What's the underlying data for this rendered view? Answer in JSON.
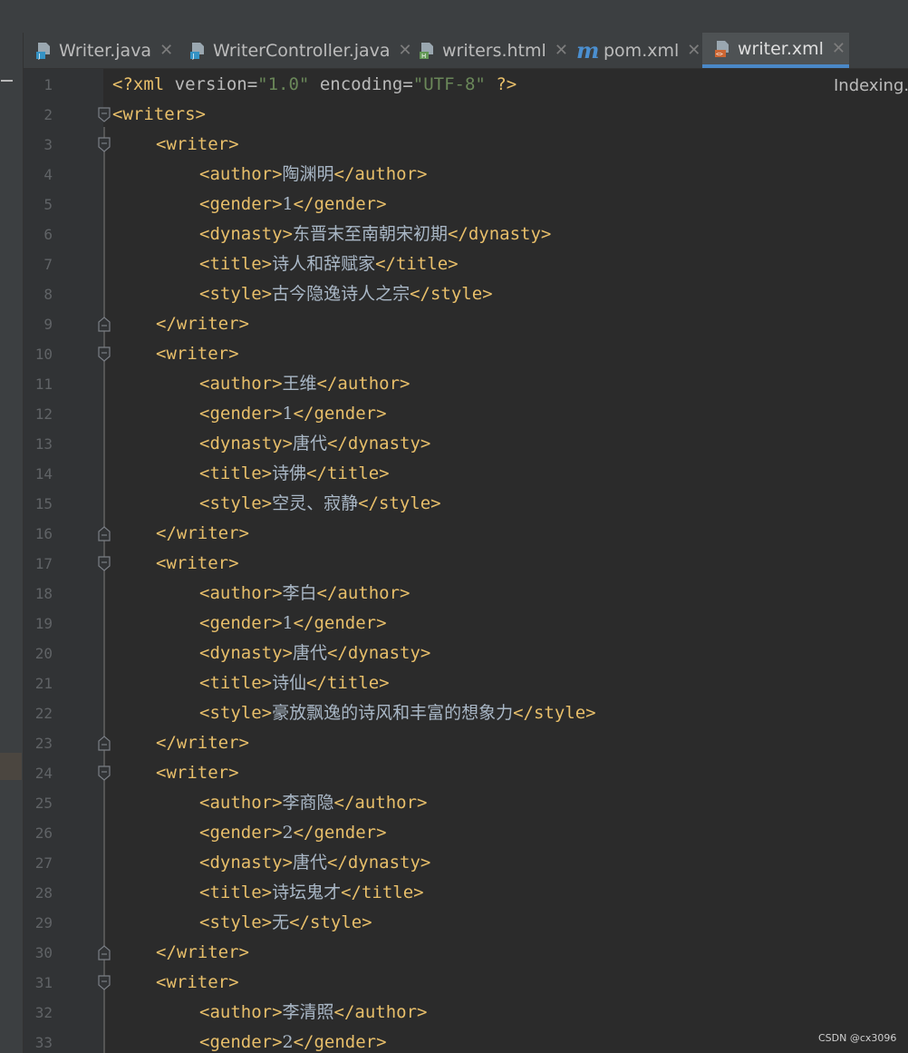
{
  "tabs": [
    {
      "label": "Writer.java",
      "icon": "java-file-icon",
      "active": false
    },
    {
      "label": "WriterController.java",
      "icon": "java-file-icon",
      "active": false
    },
    {
      "label": "writers.html",
      "icon": "html-file-icon",
      "active": false
    },
    {
      "label": "pom.xml",
      "icon": "maven-m-icon",
      "active": false
    },
    {
      "label": "writer.xml",
      "icon": "xml-file-icon",
      "active": true
    }
  ],
  "tab_close_glyph": "✕",
  "status": {
    "indexing": "Indexing..."
  },
  "watermark": "CSDN @cx3096",
  "colors": {
    "background": "#2b2b2b",
    "tag": "#e8bf6a",
    "string": "#6a8759",
    "text": "#a9b7c6",
    "active_tab_underline": "#4a88c7"
  },
  "editor": {
    "file": "writer.xml",
    "lines": [
      {
        "n": "1",
        "indent": 0,
        "fold": "",
        "kind": "decl",
        "decl_open": "<?xml ",
        "attr1": "version",
        "eq": "=",
        "val1": "\"1.0\"",
        "sp": " ",
        "attr2": "encoding",
        "val2": "\"UTF-8\"",
        "decl_close": " ?>"
      },
      {
        "n": "2",
        "indent": 0,
        "fold": "open",
        "kind": "open",
        "tag": "<writers>"
      },
      {
        "n": "3",
        "indent": 1,
        "fold": "open",
        "kind": "open",
        "tag": "<writer>"
      },
      {
        "n": "4",
        "indent": 2,
        "fold": "",
        "kind": "elem",
        "open": "<author>",
        "text": "陶渊明",
        "close": "</author>"
      },
      {
        "n": "5",
        "indent": 2,
        "fold": "",
        "kind": "elem",
        "open": "<gender>",
        "text": "1",
        "close": "</gender>"
      },
      {
        "n": "6",
        "indent": 2,
        "fold": "",
        "kind": "elem",
        "open": "<dynasty>",
        "text": "东晋末至南朝宋初期",
        "close": "</dynasty>"
      },
      {
        "n": "7",
        "indent": 2,
        "fold": "",
        "kind": "elem",
        "open": "<title>",
        "text": "诗人和辞赋家",
        "close": "</title>"
      },
      {
        "n": "8",
        "indent": 2,
        "fold": "",
        "kind": "elem",
        "open": "<style>",
        "text": "古今隐逸诗人之宗",
        "close": "</style>"
      },
      {
        "n": "9",
        "indent": 1,
        "fold": "close",
        "kind": "open",
        "tag": "</writer>"
      },
      {
        "n": "10",
        "indent": 1,
        "fold": "open",
        "kind": "open",
        "tag": "<writer>"
      },
      {
        "n": "11",
        "indent": 2,
        "fold": "",
        "kind": "elem",
        "open": "<author>",
        "text": "王维",
        "close": "</author>"
      },
      {
        "n": "12",
        "indent": 2,
        "fold": "",
        "kind": "elem",
        "open": "<gender>",
        "text": "1",
        "close": "</gender>"
      },
      {
        "n": "13",
        "indent": 2,
        "fold": "",
        "kind": "elem",
        "open": "<dynasty>",
        "text": "唐代",
        "close": "</dynasty>"
      },
      {
        "n": "14",
        "indent": 2,
        "fold": "",
        "kind": "elem",
        "open": "<title>",
        "text": "诗佛",
        "close": "</title>"
      },
      {
        "n": "15",
        "indent": 2,
        "fold": "",
        "kind": "elem",
        "open": "<style>",
        "text": "空灵、寂静",
        "close": "</style>"
      },
      {
        "n": "16",
        "indent": 1,
        "fold": "close",
        "kind": "open",
        "tag": "</writer>"
      },
      {
        "n": "17",
        "indent": 1,
        "fold": "open",
        "kind": "open",
        "tag": "<writer>"
      },
      {
        "n": "18",
        "indent": 2,
        "fold": "",
        "kind": "elem",
        "open": "<author>",
        "text": "李白",
        "close": "</author>"
      },
      {
        "n": "19",
        "indent": 2,
        "fold": "",
        "kind": "elem",
        "open": "<gender>",
        "text": "1",
        "close": "</gender>"
      },
      {
        "n": "20",
        "indent": 2,
        "fold": "",
        "kind": "elem",
        "open": "<dynasty>",
        "text": "唐代",
        "close": "</dynasty>"
      },
      {
        "n": "21",
        "indent": 2,
        "fold": "",
        "kind": "elem",
        "open": "<title>",
        "text": "诗仙",
        "close": "</title>"
      },
      {
        "n": "22",
        "indent": 2,
        "fold": "",
        "kind": "elem",
        "open": "<style>",
        "text": "豪放飘逸的诗风和丰富的想象力",
        "close": "</style>"
      },
      {
        "n": "23",
        "indent": 1,
        "fold": "close",
        "kind": "open",
        "tag": "</writer>"
      },
      {
        "n": "24",
        "indent": 1,
        "fold": "open",
        "kind": "open",
        "tag": "<writer>"
      },
      {
        "n": "25",
        "indent": 2,
        "fold": "",
        "kind": "elem",
        "open": "<author>",
        "text": "李商隐",
        "close": "</author>"
      },
      {
        "n": "26",
        "indent": 2,
        "fold": "",
        "kind": "elem",
        "open": "<gender>",
        "text": "2",
        "close": "</gender>"
      },
      {
        "n": "27",
        "indent": 2,
        "fold": "",
        "kind": "elem",
        "open": "<dynasty>",
        "text": "唐代",
        "close": "</dynasty>"
      },
      {
        "n": "28",
        "indent": 2,
        "fold": "",
        "kind": "elem",
        "open": "<title>",
        "text": "诗坛鬼才",
        "close": "</title>"
      },
      {
        "n": "29",
        "indent": 2,
        "fold": "",
        "kind": "elem",
        "open": "<style>",
        "text": "无",
        "close": "</style>"
      },
      {
        "n": "30",
        "indent": 1,
        "fold": "close",
        "kind": "open",
        "tag": "</writer>"
      },
      {
        "n": "31",
        "indent": 1,
        "fold": "open",
        "kind": "open",
        "tag": "<writer>"
      },
      {
        "n": "32",
        "indent": 2,
        "fold": "",
        "kind": "elem",
        "open": "<author>",
        "text": "李清照",
        "close": "</author>"
      },
      {
        "n": "33",
        "indent": 2,
        "fold": "",
        "kind": "elem",
        "open": "<gender>",
        "text": "2",
        "close": "</gender>"
      }
    ]
  }
}
